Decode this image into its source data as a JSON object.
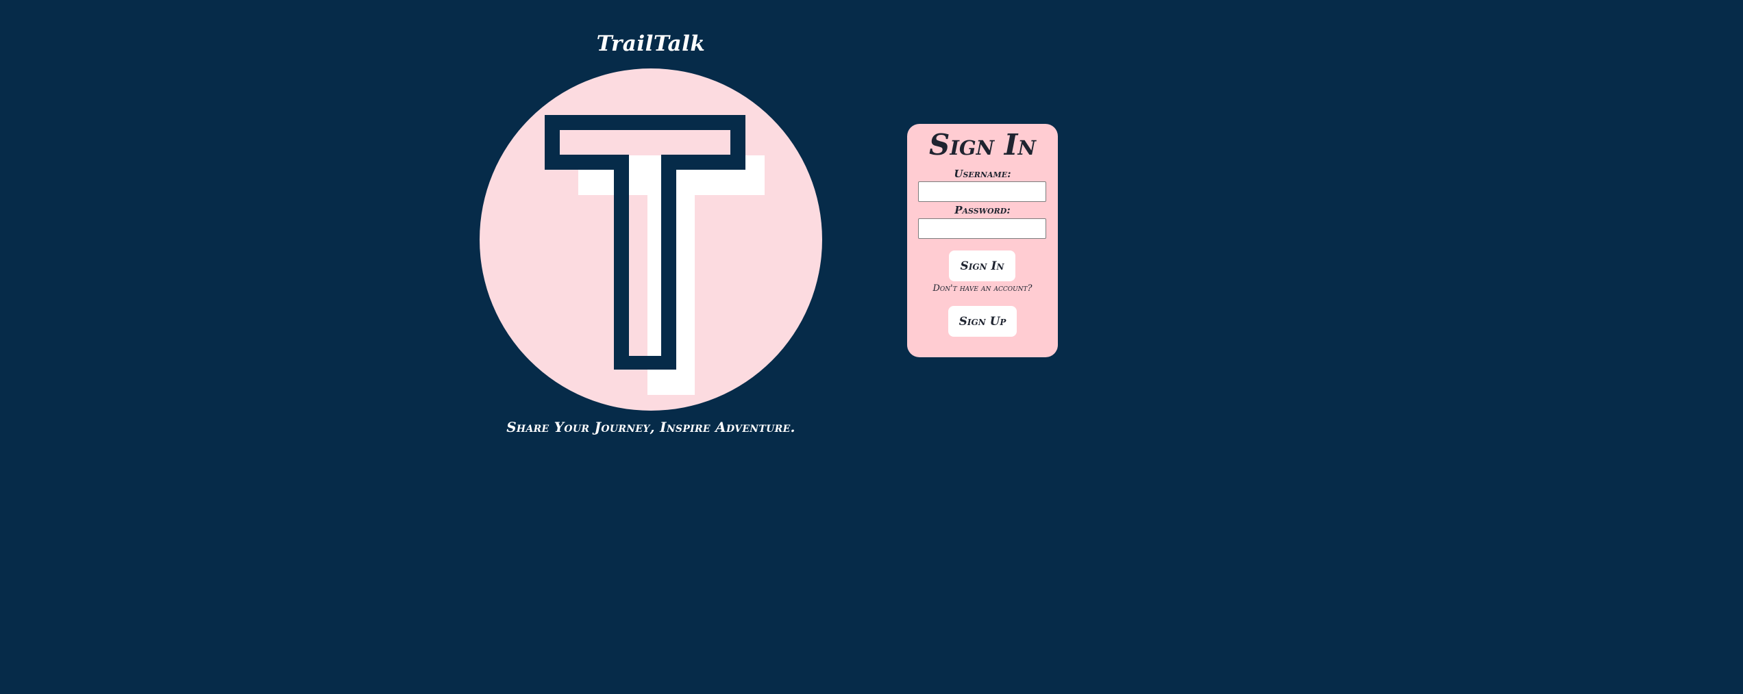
{
  "brand": {
    "title": "TrailTalk",
    "tagline": "Share Your Journey, Inspire Adventure.",
    "logo_letter": "T"
  },
  "signin": {
    "heading": "Sign In",
    "username_label": "Username:",
    "username_value": "",
    "password_label": "Password:",
    "password_value": "",
    "signin_button": "Sign In",
    "no_account_text": "Don't have an account?",
    "signup_button": "Sign Up"
  },
  "colors": {
    "background": "#062b49",
    "logo_circle": "#fcdbe0",
    "logo_letter_outline": "#062b49",
    "logo_letter_shadow": "#ffffff",
    "card_background": "#ffccd2",
    "button_background": "#ffffff",
    "text_dark": "#1f2430",
    "text_light": "#ffffff"
  }
}
